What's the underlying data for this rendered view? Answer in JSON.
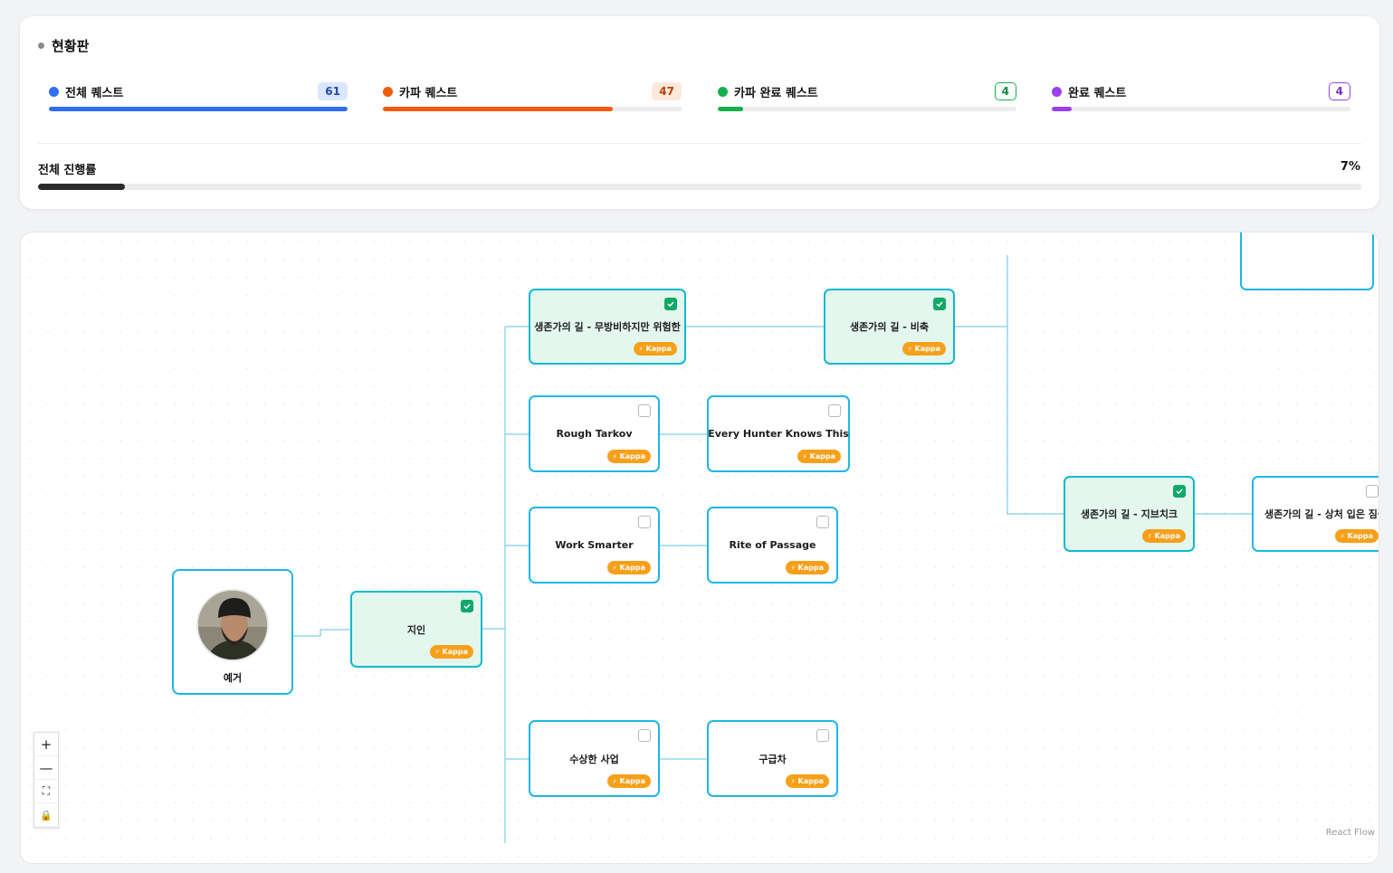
{
  "dashboard": {
    "title": "현황판",
    "stats": [
      {
        "label": "전체 퀘스트",
        "count": "61",
        "color": "#2f6df2",
        "badge_bg": "#dbe7ff",
        "badge_fg": "#2348a8",
        "progress": 1.0
      },
      {
        "label": "카파 퀘스트",
        "count": "47",
        "color": "#f45a0c",
        "badge_bg": "#fde8da",
        "badge_fg": "#b4410a",
        "progress": 0.77
      },
      {
        "label": "카파 완료 퀘스트",
        "count": "4",
        "color": "#13b14b",
        "badge_bg": "#ffffff",
        "badge_fg": "#0f8a3a",
        "progress": 0.085
      },
      {
        "label": "완료 퀘스트",
        "count": "4",
        "color": "#9b3ff0",
        "badge_bg": "#ffffff",
        "badge_fg": "#7b2fc4",
        "progress": 0.066
      }
    ],
    "overall": {
      "label": "전체 진행률",
      "percent_text": "7%",
      "progress": 0.066
    }
  },
  "flow": {
    "trader": {
      "name": "예거",
      "icon": "trader-portrait"
    },
    "kappa_label": "Kappa",
    "nodes": [
      {
        "id": "n1",
        "title": "지인",
        "done": true
      },
      {
        "id": "n2",
        "title": "생존가의 길 - 무방비하지만 위험한",
        "done": true
      },
      {
        "id": "n3",
        "title": "생존가의 길 - 비축",
        "done": true
      },
      {
        "id": "n4",
        "title": "Rough Tarkov",
        "done": false
      },
      {
        "id": "n5",
        "title": "Every Hunter Knows This",
        "done": false
      },
      {
        "id": "n6",
        "title": "Work Smarter",
        "done": false
      },
      {
        "id": "n7",
        "title": "Rite of Passage",
        "done": false
      },
      {
        "id": "n8",
        "title": "수상한 사업",
        "done": false
      },
      {
        "id": "n9",
        "title": "구급차",
        "done": false
      },
      {
        "id": "n10",
        "title": "생존가의 길 - 지브치크",
        "done": true
      },
      {
        "id": "n11",
        "title": "생존가의 길 - 상처 입은 짐승",
        "done": false
      }
    ],
    "controls": {
      "zoom_in": "+",
      "zoom_out": "—",
      "fit": "⛶",
      "lock": "🔒"
    },
    "attribution": "React Flow"
  }
}
